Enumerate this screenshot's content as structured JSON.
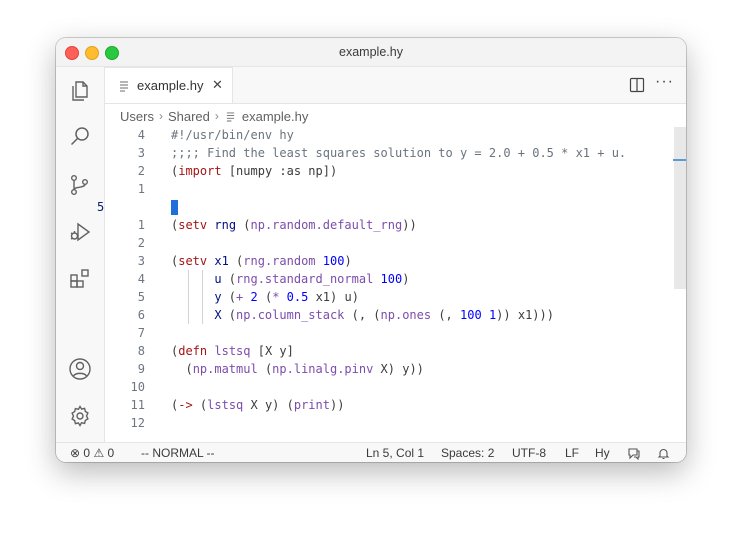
{
  "window": {
    "title": "example.hy"
  },
  "tab": {
    "label": "example.hy",
    "close": "✕"
  },
  "breadcrumb": {
    "items": [
      "Users",
      "Shared",
      "example.hy"
    ],
    "sep": "›"
  },
  "editor": {
    "current_line_number": "5",
    "lines": [
      {
        "num": "4",
        "segments": [
          {
            "t": "#!/usr/bin/env hy",
            "c": "cmt"
          }
        ]
      },
      {
        "num": "3",
        "segments": [
          {
            "t": ";;;; Find the least squares solution to y = 2.0 + 0.5 * x1 + u.",
            "c": "cmt"
          }
        ]
      },
      {
        "num": "2",
        "segments": [
          {
            "t": "(",
            "c": "op"
          },
          {
            "t": "import",
            "c": "mac"
          },
          {
            "t": " [numpy :as np])",
            "c": "op"
          }
        ]
      },
      {
        "num": "1",
        "segments": []
      },
      {
        "num": "5",
        "segments": []
      },
      {
        "num": "1",
        "segments": [
          {
            "t": "(",
            "c": "op"
          },
          {
            "t": "setv",
            "c": "mac"
          },
          {
            "t": " rng ",
            "c": "var"
          },
          {
            "t": "(",
            "c": "op"
          },
          {
            "t": "np.random.default_rng",
            "c": "mth"
          },
          {
            "t": "))",
            "c": "op"
          }
        ]
      },
      {
        "num": "2",
        "segments": []
      },
      {
        "num": "3",
        "segments": [
          {
            "t": "(",
            "c": "op"
          },
          {
            "t": "setv",
            "c": "mac"
          },
          {
            "t": " x1 ",
            "c": "var"
          },
          {
            "t": "(",
            "c": "op"
          },
          {
            "t": "rng.random",
            "c": "mth"
          },
          {
            "t": " ",
            "c": "op"
          },
          {
            "t": "100",
            "c": "kw2"
          },
          {
            "t": ")",
            "c": "op"
          }
        ]
      },
      {
        "num": "4",
        "segments": [
          {
            "t": "      u ",
            "c": "var"
          },
          {
            "t": "(",
            "c": "op"
          },
          {
            "t": "rng.standard_normal",
            "c": "mth"
          },
          {
            "t": " ",
            "c": "op"
          },
          {
            "t": "100",
            "c": "kw2"
          },
          {
            "t": ")",
            "c": "op"
          }
        ]
      },
      {
        "num": "5",
        "segments": [
          {
            "t": "      y ",
            "c": "var"
          },
          {
            "t": "(",
            "c": "op"
          },
          {
            "t": "+",
            "c": "mth"
          },
          {
            "t": " ",
            "c": "op"
          },
          {
            "t": "2",
            "c": "kw2"
          },
          {
            "t": " (",
            "c": "op"
          },
          {
            "t": "*",
            "c": "mth"
          },
          {
            "t": " ",
            "c": "op"
          },
          {
            "t": "0.5",
            "c": "kw2"
          },
          {
            "t": " x1) u)",
            "c": "op"
          }
        ]
      },
      {
        "num": "6",
        "segments": [
          {
            "t": "      X ",
            "c": "var"
          },
          {
            "t": "(",
            "c": "op"
          },
          {
            "t": "np.column_stack",
            "c": "mth"
          },
          {
            "t": " (, (",
            "c": "op"
          },
          {
            "t": "np.ones",
            "c": "mth"
          },
          {
            "t": " (, ",
            "c": "op"
          },
          {
            "t": "100",
            "c": "kw2"
          },
          {
            "t": " ",
            "c": "op"
          },
          {
            "t": "1",
            "c": "kw2"
          },
          {
            "t": ")) x1)))",
            "c": "op"
          }
        ]
      },
      {
        "num": "7",
        "segments": []
      },
      {
        "num": "8",
        "segments": [
          {
            "t": "(",
            "c": "op"
          },
          {
            "t": "defn",
            "c": "mac"
          },
          {
            "t": " lstsq",
            "c": "mth"
          },
          {
            "t": " [X y]",
            "c": "op"
          }
        ]
      },
      {
        "num": "9",
        "segments": [
          {
            "t": "  (",
            "c": "op"
          },
          {
            "t": "np.matmul",
            "c": "mth"
          },
          {
            "t": " (",
            "c": "op"
          },
          {
            "t": "np.linalg.pinv",
            "c": "mth"
          },
          {
            "t": " X) y))",
            "c": "op"
          }
        ]
      },
      {
        "num": "10",
        "segments": []
      },
      {
        "num": "11",
        "segments": [
          {
            "t": "(",
            "c": "op"
          },
          {
            "t": "->",
            "c": "mac"
          },
          {
            "t": " (",
            "c": "op"
          },
          {
            "t": "lstsq",
            "c": "mth"
          },
          {
            "t": " X y) (",
            "c": "op"
          },
          {
            "t": "print",
            "c": "mth"
          },
          {
            "t": "))",
            "c": "op"
          }
        ]
      },
      {
        "num": "12",
        "segments": []
      }
    ]
  },
  "statusbar": {
    "errors": "0",
    "warnings": "0",
    "mode": "-- NORMAL --",
    "position": "Ln 5, Col 1",
    "spaces": "Spaces: 2",
    "encoding": "UTF-8",
    "eol": "LF",
    "language": "Hy"
  },
  "colors": {
    "accent": "#1e6fd9",
    "close": "#fe5f57",
    "minimize": "#febc2e",
    "maximize": "#28c840"
  },
  "icons": {
    "activity": [
      "explorer-icon",
      "search-icon",
      "source-control-icon",
      "run-debug-icon",
      "extensions-icon",
      "account-icon",
      "settings-gear-icon"
    ]
  }
}
